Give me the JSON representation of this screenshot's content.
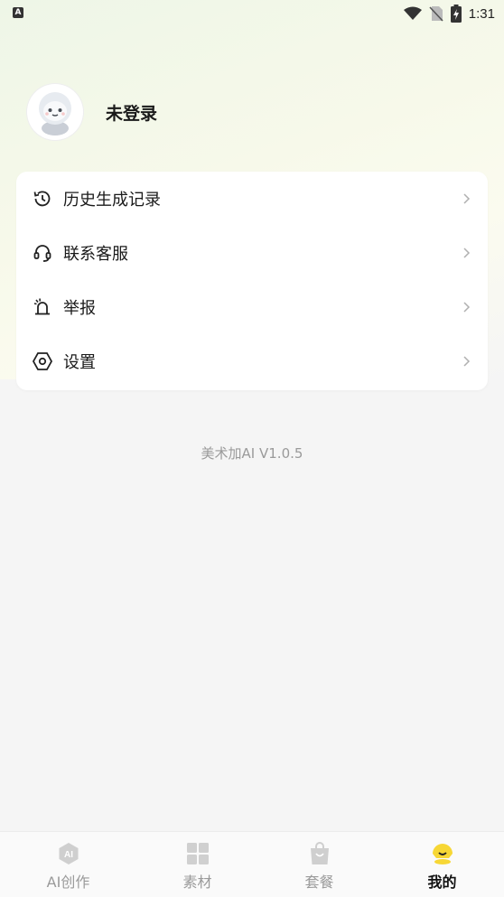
{
  "status_bar": {
    "time": "1:31",
    "notification_icon": "A"
  },
  "profile": {
    "username": "未登录",
    "avatar_icon": "robot-avatar-icon"
  },
  "menu": {
    "items": [
      {
        "label": "历史生成记录",
        "icon": "history-icon"
      },
      {
        "label": "联系客服",
        "icon": "headset-icon"
      },
      {
        "label": "举报",
        "icon": "alarm-icon"
      },
      {
        "label": "设置",
        "icon": "settings-icon"
      }
    ]
  },
  "version": "美术加AI V1.0.5",
  "bottom_nav": {
    "items": [
      {
        "label": "AI创作",
        "icon": "ai-create-icon",
        "active": false
      },
      {
        "label": "素材",
        "icon": "grid-icon",
        "active": false
      },
      {
        "label": "套餐",
        "icon": "bag-icon",
        "active": false
      },
      {
        "label": "我的",
        "icon": "profile-smile-icon",
        "active": true
      }
    ]
  },
  "colors": {
    "accent": "#f7d735",
    "inactive": "#9a9a9a",
    "text": "#1a1a1a"
  }
}
